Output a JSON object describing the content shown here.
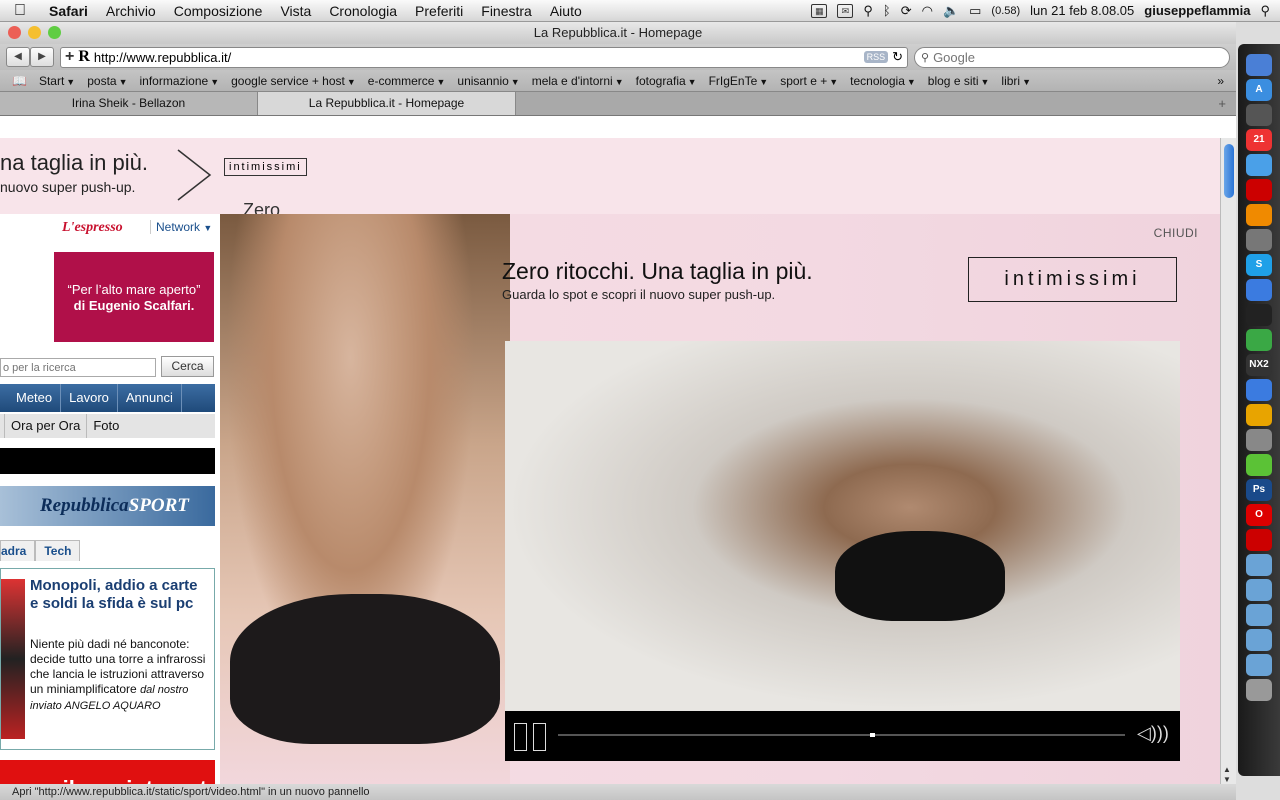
{
  "menubar": {
    "app": "Safari",
    "items": [
      "Archivio",
      "Composizione",
      "Vista",
      "Cronologia",
      "Preferiti",
      "Finestra",
      "Aiuto"
    ],
    "battery": "(0.58)",
    "clock": "lun 21 feb  8.08.05",
    "user": "giuseppeflammia"
  },
  "window": {
    "title": "La Repubblica.it - Homepage",
    "url": "http://www.repubblica.it/",
    "rss": "RSS",
    "search_placeholder": "Google"
  },
  "bookmarks": [
    "Start",
    "posta",
    "informazione",
    "google service + host",
    "e-commerce",
    "unisannio",
    "mela e d'intorni",
    "fotografia",
    "FrIgEnTe",
    "sport e +",
    "tecnologia",
    "blog e siti",
    "libri"
  ],
  "tabs": [
    {
      "label": "Irina Sheik - Bellazon",
      "active": false
    },
    {
      "label": "La Repubblica.it - Homepage",
      "active": true
    }
  ],
  "top_banner": {
    "line1": "na taglia in più.",
    "line2": "nuovo super push-up.",
    "logo": "intimissimi",
    "peek": "Zero"
  },
  "left": {
    "espresso": "L'espresso",
    "network": "Network",
    "scalfari_line1": "“Per l’alto mare aperto”",
    "scalfari_line2": "di Eugenio Scalfari.",
    "search_placeholder": "o per la ricerca",
    "search_button": "Cerca",
    "blue_nav": [
      "Meteo",
      "Lavoro",
      "Annunci"
    ],
    "grey_nav": [
      "Ora per Ora",
      "Foto"
    ],
    "sport_logo_a": "Repubblica",
    "sport_logo_b": "SPORT",
    "mini_tabs": [
      "adra",
      "Tech"
    ],
    "news_title": "Monopoli, addio a carte e soldi la sfida è sul pc",
    "news_body": "Niente più dadi né banconote: decide tutto una torre a infrarossi che lancia le istruzioni attraverso un miniamplificatore",
    "news_byline": "dal nostro inviato ANGELO AQUARO",
    "red_ad": "cuno il suo internet"
  },
  "overlay": {
    "close": "CHIUDI",
    "headline": "Zero ritocchi. Una taglia in più.",
    "subline": "Guarda lo spot e scopri il nuovo super push-up.",
    "logo": "intimissimi",
    "video_progress": 0.55
  },
  "status": "Apri \"http://www.repubblica.it/static/sport/video.html\" in un nuovo pannello",
  "dock": [
    {
      "icon": "finder-icon",
      "color": "#4a7fd6",
      "label": ""
    },
    {
      "icon": "appstore-icon",
      "color": "#3b8ee0",
      "label": "A"
    },
    {
      "icon": "dashboard-icon",
      "color": "#555",
      "label": ""
    },
    {
      "icon": "ical-icon",
      "color": "#e33",
      "label": "21"
    },
    {
      "icon": "safari-icon",
      "color": "#4aa0e8",
      "label": ""
    },
    {
      "icon": "flashcard-icon",
      "color": "#c00",
      "label": ""
    },
    {
      "icon": "vlc-icon",
      "color": "#f08a00",
      "label": ""
    },
    {
      "icon": "utility-icon",
      "color": "#777",
      "label": ""
    },
    {
      "icon": "skype-icon",
      "color": "#1fa0e8",
      "label": "S"
    },
    {
      "icon": "home-icon",
      "color": "#3b7be0",
      "label": ""
    },
    {
      "icon": "terminal-icon",
      "color": "#222",
      "label": ""
    },
    {
      "icon": "messenger-icon",
      "color": "#3aa845",
      "label": ""
    },
    {
      "icon": "nx-icon",
      "color": "#333",
      "label": "NX2"
    },
    {
      "icon": "itunes-icon",
      "color": "#3b7be0",
      "label": ""
    },
    {
      "icon": "chrome-icon",
      "color": "#e8a400",
      "label": ""
    },
    {
      "icon": "network-icon",
      "color": "#888",
      "label": ""
    },
    {
      "icon": "evernote-icon",
      "color": "#5bc236",
      "label": ""
    },
    {
      "icon": "photoshop-icon",
      "color": "#1a4a8a",
      "label": "Ps"
    },
    {
      "icon": "opera-icon",
      "color": "#d00",
      "label": "O"
    },
    {
      "icon": "acrobat-icon",
      "color": "#c00",
      "label": ""
    },
    {
      "icon": "folder-icon",
      "color": "#6aa3d6",
      "label": ""
    },
    {
      "icon": "folder-icon",
      "color": "#6aa3d6",
      "label": ""
    },
    {
      "icon": "folder-icon",
      "color": "#6aa3d6",
      "label": ""
    },
    {
      "icon": "folder-icon",
      "color": "#6aa3d6",
      "label": ""
    },
    {
      "icon": "folder-icon",
      "color": "#6aa3d6",
      "label": ""
    },
    {
      "icon": "trash-icon",
      "color": "#999",
      "label": ""
    }
  ]
}
